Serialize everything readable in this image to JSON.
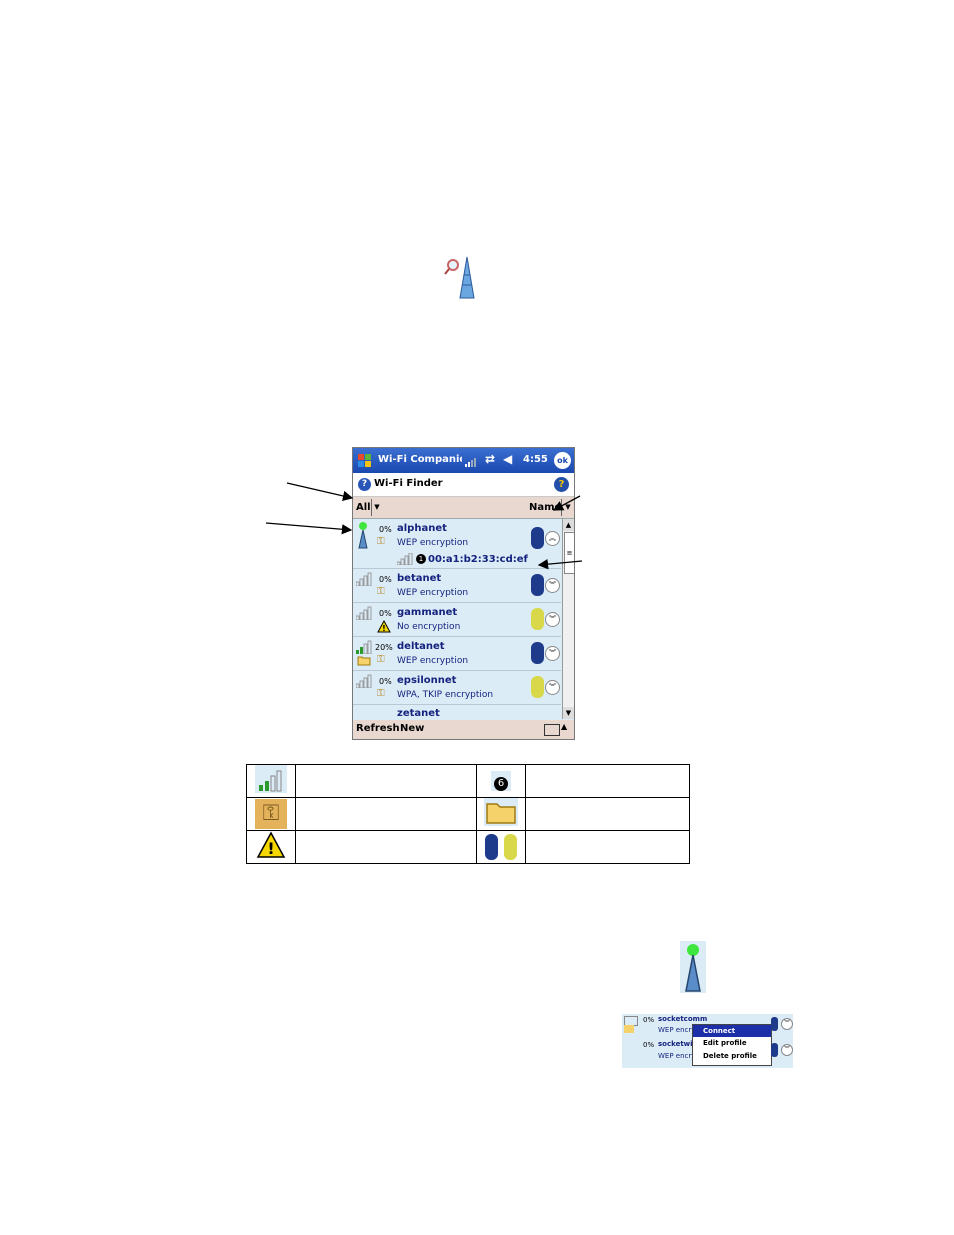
{
  "pda": {
    "titlebar": {
      "title": "Wi-Fi Companion",
      "time": "4:55",
      "ok": "ok"
    },
    "appbar": {
      "title": "Wi-Fi Finder",
      "help": "?"
    },
    "filterbar": {
      "filter": "All",
      "sort": "Name"
    },
    "networks": [
      {
        "pct": "0%",
        "name": "alphanet",
        "enc": "WEP encryption",
        "mac_badge": "1",
        "mac": "00:a1:b2:33:cd:ef",
        "signal": 0,
        "connected": true
      },
      {
        "pct": "0%",
        "name": "betanet",
        "enc": "WEP encryption",
        "signal": 0
      },
      {
        "pct": "0%",
        "name": "gammanet",
        "enc": "No encryption",
        "signal": 0
      },
      {
        "pct": "20%",
        "name": "deltanet",
        "enc": "WEP encryption",
        "signal": 0.2
      },
      {
        "pct": "0%",
        "name": "epsilonnet",
        "enc": "WPA, TKIP encryption",
        "signal": 0
      },
      {
        "name": "zetanet"
      }
    ],
    "menubar": {
      "refresh": "Refresh",
      "new": "New"
    }
  },
  "legend": {
    "badge": "6"
  },
  "context": {
    "rows": [
      {
        "pct": "0%",
        "name": "socketcomm",
        "enc": "WEP encry"
      },
      {
        "pct": "0%",
        "name": "socketwi",
        "enc": "WEP encry"
      }
    ],
    "menu": [
      "Connect",
      "Edit profile",
      "Delete profile"
    ]
  },
  "colors": {
    "accent": "#14237e",
    "title_blue": "#2454c0",
    "list_bg": "#dcecf7",
    "bar_bg": "#e8d8d0"
  }
}
